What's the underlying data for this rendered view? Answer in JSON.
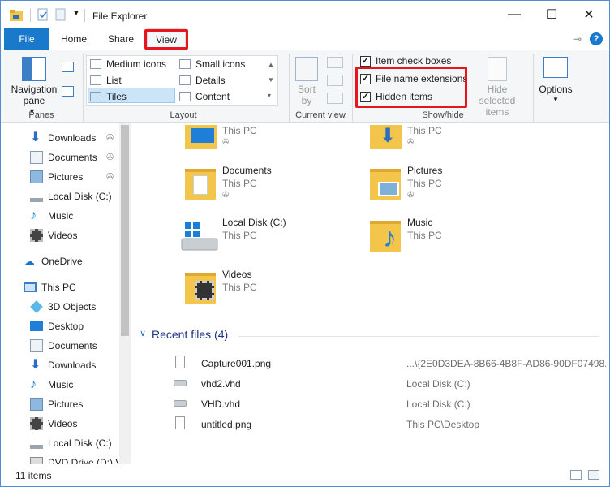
{
  "window": {
    "title": "File Explorer",
    "minimize": "—",
    "maximize": "☐",
    "close": "✕"
  },
  "tabs": {
    "file": "File",
    "home": "Home",
    "share": "Share",
    "view": "View",
    "help": "?"
  },
  "ribbon": {
    "panes": {
      "navigation_pane": "Navigation pane",
      "label": "Panes"
    },
    "layout": {
      "medium_icons": "Medium icons",
      "small_icons": "Small icons",
      "list": "List",
      "details": "Details",
      "tiles": "Tiles",
      "content": "Content",
      "label": "Layout"
    },
    "current_view": {
      "sort_by": "Sort by",
      "label": "Current view"
    },
    "show_hide": {
      "item_check_boxes": "Item check boxes",
      "file_name_extensions": "File name extensions",
      "hidden_items": "Hidden items",
      "hide_selected_items": "Hide selected items",
      "label": "Show/hide"
    },
    "options": "Options"
  },
  "nav": {
    "quick": [
      {
        "label": "Downloads"
      },
      {
        "label": "Documents"
      },
      {
        "label": "Pictures"
      },
      {
        "label": "Local Disk (C:)"
      },
      {
        "label": "Music"
      },
      {
        "label": "Videos"
      }
    ],
    "onedrive": "OneDrive",
    "thispc": "This PC",
    "pc_items": [
      {
        "label": "3D Objects"
      },
      {
        "label": "Desktop"
      },
      {
        "label": "Documents"
      },
      {
        "label": "Downloads"
      },
      {
        "label": "Music"
      },
      {
        "label": "Pictures"
      },
      {
        "label": "Videos"
      },
      {
        "label": "Local Disk (C:)"
      },
      {
        "label": "DVD Drive (D:) V"
      }
    ]
  },
  "tiles": [
    {
      "name": "",
      "sub": "This PC"
    },
    {
      "name": "",
      "sub": "This PC"
    },
    {
      "name": "Documents",
      "sub": "This PC"
    },
    {
      "name": "Pictures",
      "sub": "This PC"
    },
    {
      "name": "Local Disk (C:)",
      "sub": "This PC"
    },
    {
      "name": "Music",
      "sub": "This PC"
    },
    {
      "name": "Videos",
      "sub": "This PC"
    }
  ],
  "recent": {
    "header": "Recent files (4)",
    "files": [
      {
        "name": "Capture001.png",
        "location": "...\\{2E0D3DEA-8B66-4B8F-AD86-90DF07498..."
      },
      {
        "name": "vhd2.vhd",
        "location": "Local Disk (C:)"
      },
      {
        "name": "VHD.vhd",
        "location": "Local Disk (C:)"
      },
      {
        "name": "untitled.png",
        "location": "This PC\\Desktop"
      }
    ]
  },
  "status": {
    "count": "11 items"
  },
  "colors": {
    "accent": "#1979ca",
    "highlight": "#e8141e",
    "folder": "#f3c54a"
  }
}
